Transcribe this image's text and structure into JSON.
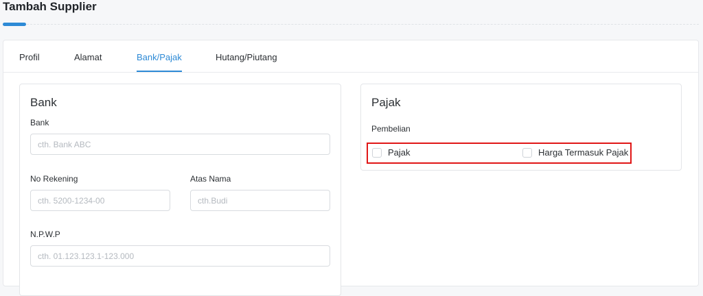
{
  "page": {
    "title": "Tambah Supplier"
  },
  "tabs": [
    {
      "label": "Profil",
      "active": false
    },
    {
      "label": "Alamat",
      "active": false
    },
    {
      "label": "Bank/Pajak",
      "active": true
    },
    {
      "label": "Hutang/Piutang",
      "active": false
    }
  ],
  "bank": {
    "title": "Bank",
    "bank_label": "Bank",
    "bank_placeholder": "cth. Bank ABC",
    "rekening_label": "No Rekening",
    "rekening_placeholder": "cth. 5200-1234-00",
    "atas_nama_label": "Atas Nama",
    "atas_nama_placeholder": "cth.Budi",
    "npwp_label": "N.P.W.P",
    "npwp_placeholder": "cth. 01.123.123.1-123.000"
  },
  "pajak": {
    "title": "Pajak",
    "pembelian_label": "Pembelian",
    "pajak_checkbox": {
      "label": "Pajak",
      "checked": false
    },
    "harga_termasuk_checkbox": {
      "label": "Harga Termasuk Pajak",
      "checked": false
    }
  },
  "colors": {
    "accent": "#2d8ad6",
    "highlight": "#e01515"
  }
}
